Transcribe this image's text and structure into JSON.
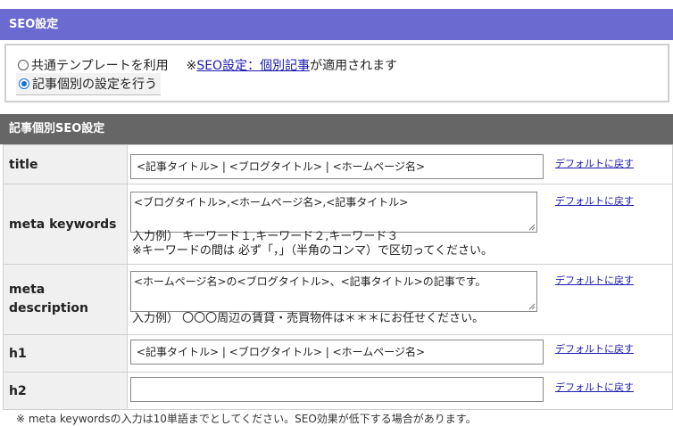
{
  "seo_header": "SEO設定",
  "mode": {
    "option_common": "共通テンプレートを利用",
    "note_prefix": "※",
    "note_link": "SEO設定：個別記事",
    "note_suffix": "が適用されます",
    "option_individual": "記事個別の設定を行う",
    "selected": "individual"
  },
  "sub_header": "記事個別SEO設定",
  "default_link": "デフォルトに戻す",
  "fields": {
    "title": {
      "label": "title",
      "value": "<記事タイトル> | <ブログタイトル> | <ホームページ名>"
    },
    "keywords": {
      "label": "meta keywords",
      "value": "<ブログタイトル>,<ホームページ名>,<記事タイトル>",
      "example1": "入力例）  キーワード１,キーワード２,キーワード３",
      "example2": "※キーワードの間は   必ず「，」（半角のコンマ）で区切ってください。"
    },
    "description": {
      "label_line1": "meta",
      "label_line2": "description",
      "value": "<ホームページ名>の<ブログタイトル>、<記事タイトル>の記事です。",
      "example": "入力例）  〇〇〇周辺の賃貸・売買物件は＊＊＊にお任せください。"
    },
    "h1": {
      "label": "h1",
      "value": "<記事タイトル> | <ブログタイトル> | <ホームページ名>"
    },
    "h2": {
      "label": "h2",
      "value": ""
    }
  },
  "footer_note": "※ meta keywordsの入力は10単語までとしてください。SEO効果が低下する場合があります。"
}
